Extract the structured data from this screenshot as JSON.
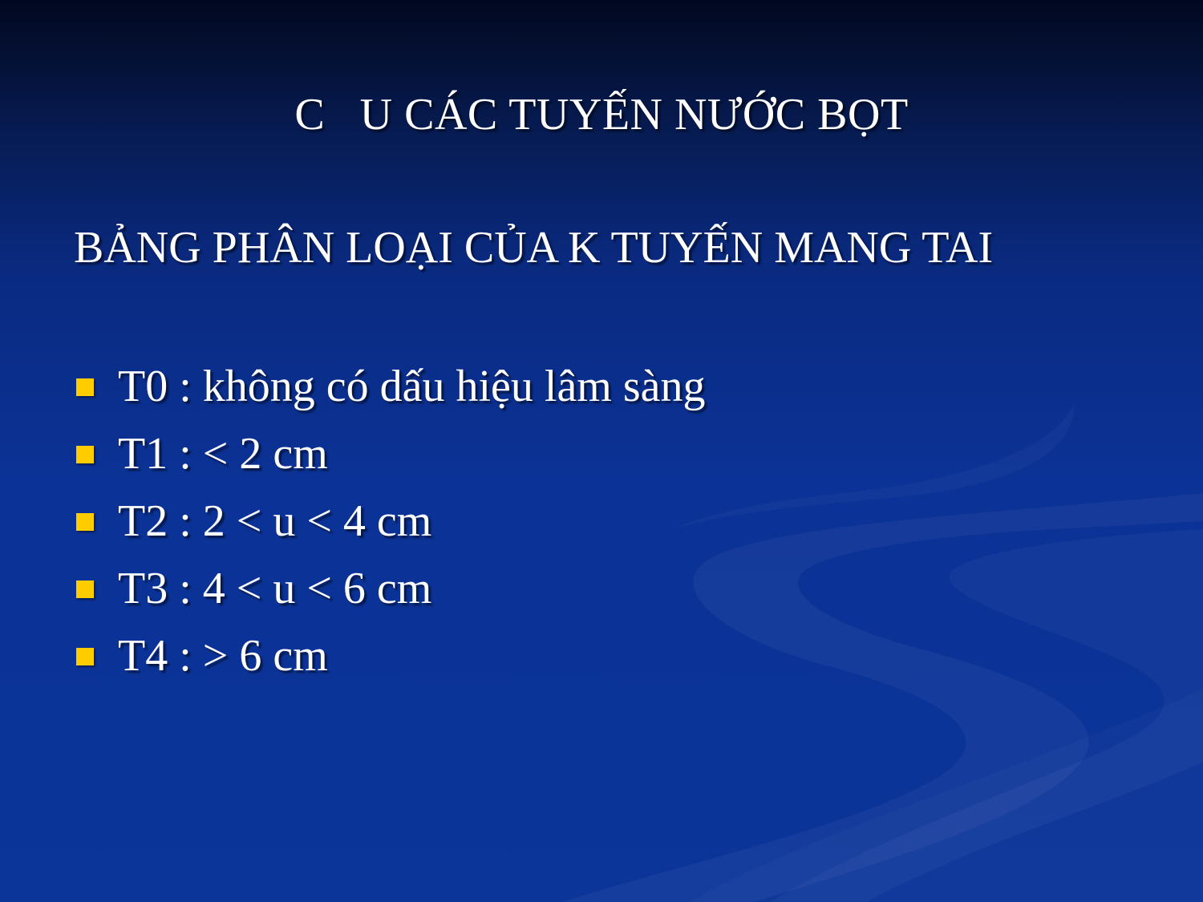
{
  "slide": {
    "title": "C   U CÁC TUYẾN NƯỚC BỌT",
    "subtitle": "BẢNG PHÂN LOẠI CỦA K TUYẾN MANG TAI",
    "bullet_icon": "square-bullet-icon",
    "colors": {
      "text": "#ffffff",
      "bullet": "#ffcc00",
      "background_top": "#02081f",
      "background_bottom": "#0b3599"
    },
    "bullets": [
      "T0 : không có dấu hiệu lâm sàng",
      "T1 : < 2 cm",
      "T2 : 2 < u < 4 cm",
      "T3 : 4 < u < 6 cm",
      "T4 : > 6 cm"
    ]
  }
}
